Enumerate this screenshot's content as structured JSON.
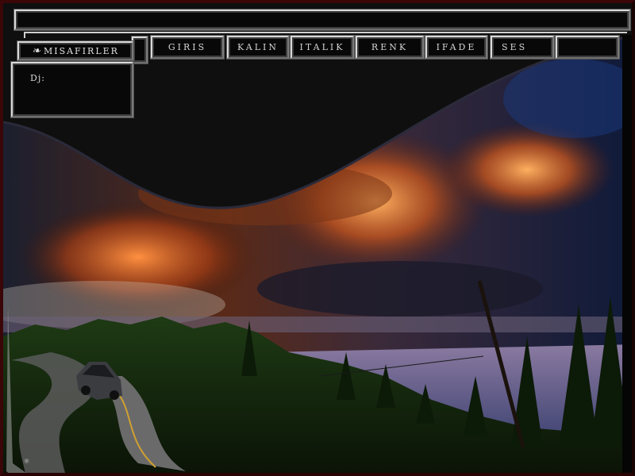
{
  "nav": {
    "items": [
      {
        "key": "giris",
        "label": "GIRIS"
      },
      {
        "key": "kalin",
        "label": "KALIN"
      },
      {
        "key": "italik",
        "label": "ITALIK"
      },
      {
        "key": "renk",
        "label": "RENK"
      },
      {
        "key": "ifade",
        "label": "IFADE"
      },
      {
        "key": "ses",
        "label": "SES"
      }
    ]
  },
  "sidebar": {
    "users_tab": {
      "label": "MISAFIRLER",
      "icon": "guest-icon"
    },
    "dj_label": "Dj:"
  },
  "colors": {
    "frame_accent": "#3a0608",
    "chrome_light": "#d9d9d9",
    "chrome_dark": "#7a7a7a"
  }
}
